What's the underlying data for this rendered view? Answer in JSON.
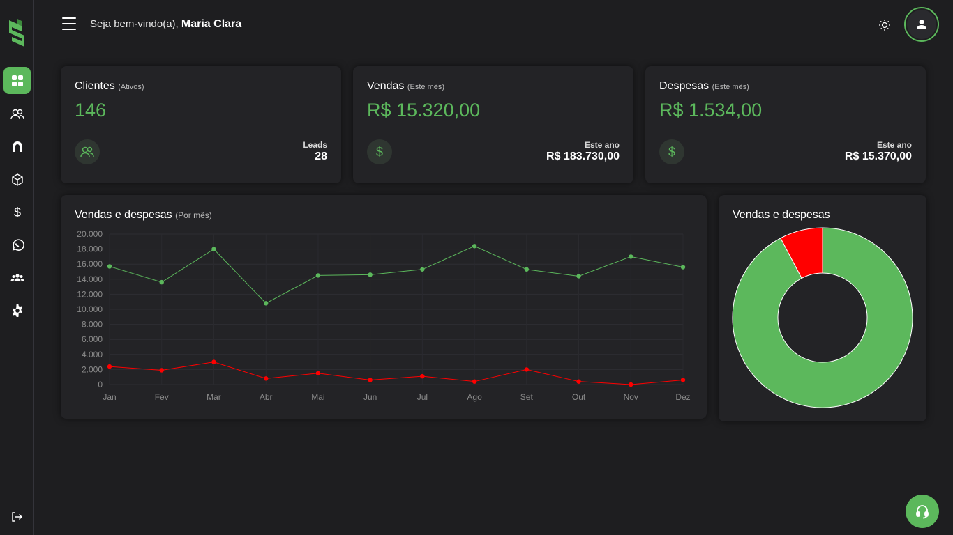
{
  "header": {
    "welcome_prefix": "Seja bem-vindo(a),",
    "user_name": "Maria Clara"
  },
  "sidebar": {
    "items": [
      {
        "icon": "dashboard-icon",
        "active": true
      },
      {
        "icon": "users-icon",
        "active": false
      },
      {
        "icon": "magnet-icon",
        "active": false
      },
      {
        "icon": "box-icon",
        "active": false
      },
      {
        "icon": "dollar-icon",
        "active": false
      },
      {
        "icon": "whatsapp-icon",
        "active": false
      },
      {
        "icon": "team-icon",
        "active": false
      },
      {
        "icon": "gear-icon",
        "active": false
      }
    ]
  },
  "cards": {
    "clientes": {
      "title": "Clientes",
      "subtitle": "(Ativos)",
      "value": "146",
      "right_label": "Leads",
      "right_value": "28"
    },
    "vendas": {
      "title": "Vendas",
      "subtitle": "(Este mês)",
      "value": "R$ 15.320,00",
      "right_label": "Este ano",
      "right_value": "R$ 183.730,00"
    },
    "despesas": {
      "title": "Despesas",
      "subtitle": "(Este mês)",
      "value": "R$ 1.534,00",
      "right_label": "Este ano",
      "right_value": "R$ 15.370,00"
    }
  },
  "line_chart": {
    "title": "Vendas e despesas",
    "subtitle": "(Por mês)"
  },
  "donut_chart": {
    "title": "Vendas e despesas"
  },
  "colors": {
    "accent": "#5cb85c",
    "expense": "#ff0000",
    "background": "#1e1e20",
    "card": "#232326"
  },
  "chart_data": [
    {
      "type": "line",
      "categories": [
        "Jan",
        "Fev",
        "Mar",
        "Abr",
        "Mai",
        "Jun",
        "Jul",
        "Ago",
        "Set",
        "Out",
        "Nov",
        "Dez"
      ],
      "series": [
        {
          "color": "#5cb85c",
          "values": [
            15700,
            13600,
            18000,
            10800,
            14500,
            14600,
            15300,
            18400,
            15300,
            14400,
            17000,
            15600
          ]
        },
        {
          "color": "#ff0000",
          "values": [
            2400,
            1900,
            3000,
            800,
            1500,
            600,
            1100,
            400,
            2000,
            400,
            0,
            600
          ]
        }
      ],
      "yticks": [
        "20.000",
        "18.000",
        "16.000",
        "14.000",
        "12.000",
        "10.000",
        "8.000",
        "6.000",
        "4.000",
        "2.000",
        "0"
      ],
      "ylim": [
        0,
        20000
      ],
      "grid": true
    },
    {
      "type": "pie",
      "hole": true,
      "slices": [
        {
          "color": "#5cb85c",
          "value": 183730
        },
        {
          "color": "#ff0000",
          "value": 15370
        }
      ]
    }
  ]
}
